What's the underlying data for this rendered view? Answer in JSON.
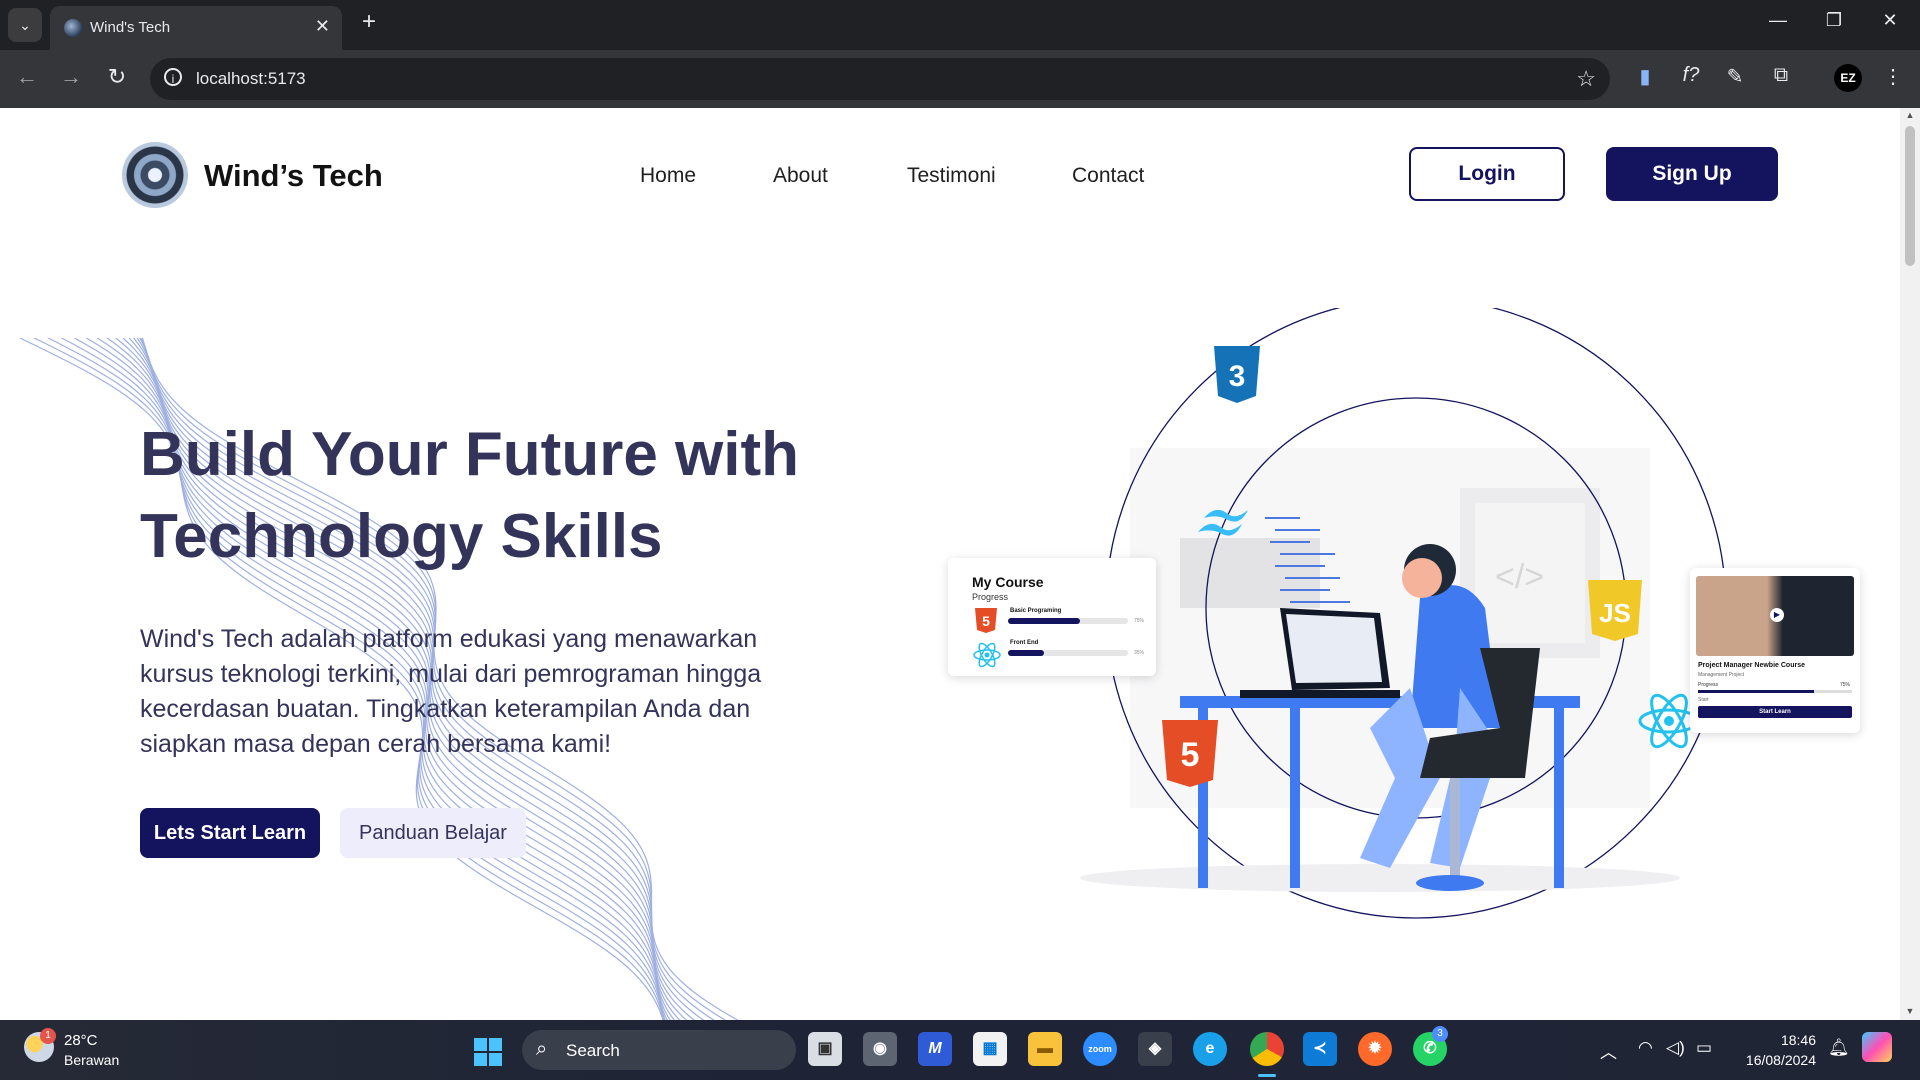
{
  "browser": {
    "tab_title": "Wind's Tech",
    "tab_close": "✕",
    "new_tab": "+",
    "url": "localhost:5173",
    "window_controls": {
      "minimize": "—",
      "restore": "❐",
      "close": "✕"
    },
    "profile_initials": "EZ",
    "icons": [
      "chevron-down-icon",
      "back-icon",
      "forward-icon",
      "reload-icon",
      "info-icon",
      "star-icon",
      "extension-icon",
      "function-icon",
      "eyedropper-icon",
      "puzzle-icon",
      "more-icon"
    ]
  },
  "site": {
    "brand_name": "Wind’s Tech",
    "nav": [
      "Home",
      "About",
      "Testimoni",
      "Contact"
    ],
    "login_label": "Login",
    "signup_label": "Sign Up",
    "hero_title": "Build Your Future with Technology Skills",
    "hero_desc": "Wind's Tech adalah platform edukasi yang menawarkan kursus teknologi terkini, mulai dari pemrograman hingga kecerdasan buatan. Tingkatkan keterampilan Anda dan siapkan masa depan cerah bersama kami!",
    "start_label": "Lets Start Learn",
    "guide_label": "Panduan Belajar",
    "colors": {
      "primary": "#13135e",
      "heading": "#34345a",
      "secondary_bg": "#ededfb"
    }
  },
  "my_course_card": {
    "title": "My Course",
    "subtitle": "Progress",
    "rows": [
      {
        "label": "Basic Programing",
        "progress": 0.6,
        "pct": "75%"
      },
      {
        "label": "Front End",
        "progress": 0.3,
        "pct": "35%"
      }
    ]
  },
  "project_card": {
    "title": "Project Manager Newbie Course",
    "subtitle": "Management Project",
    "progress_label": "Progress",
    "progress_pct": "75%",
    "progress": 0.75,
    "meta": "Start",
    "button": "Start Learn"
  },
  "tech_badges": [
    "CSS3",
    "HTML5",
    "JS",
    "React",
    "Tailwind"
  ],
  "taskbar": {
    "weather_temp": "28°C",
    "weather_desc": "Berawan",
    "weather_badge": "1",
    "search_label": "Search",
    "zoom_label": "zoom",
    "whatsapp_badge": "3",
    "time": "18:46",
    "date": "16/08/2024"
  }
}
